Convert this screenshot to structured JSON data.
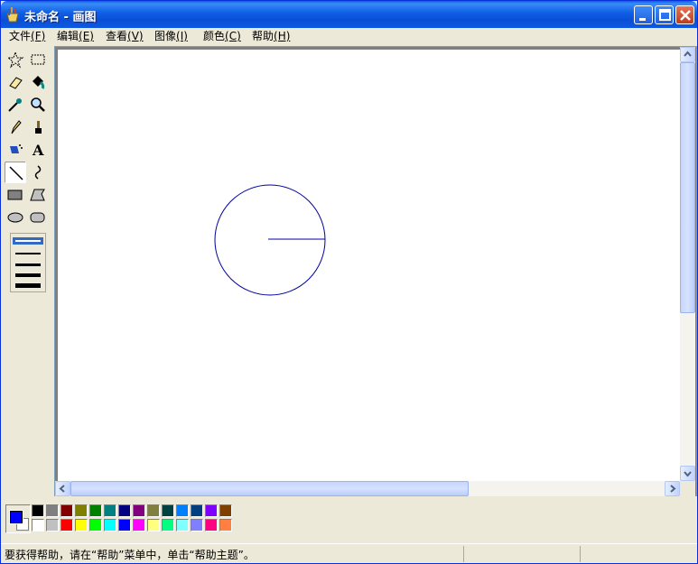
{
  "window": {
    "title": "未命名 - 画图",
    "minimize_label": "",
    "maximize_label": "",
    "close_label": ""
  },
  "menu": {
    "items": [
      {
        "label": "文件",
        "key": "(F)"
      },
      {
        "label": "编辑",
        "key": "(E)"
      },
      {
        "label": "查看",
        "key": "(V)"
      },
      {
        "label": "图像",
        "key": "(I)"
      },
      {
        "label": "颜色",
        "key": "(C)"
      },
      {
        "label": "帮助",
        "key": "(H)"
      }
    ]
  },
  "toolbox": {
    "tools": [
      {
        "name": "free-form-select",
        "icon": "star-select-icon"
      },
      {
        "name": "rect-select",
        "icon": "rect-select-icon"
      },
      {
        "name": "eraser",
        "icon": "eraser-icon"
      },
      {
        "name": "fill",
        "icon": "paint-bucket-icon"
      },
      {
        "name": "pick-color",
        "icon": "eyedropper-icon"
      },
      {
        "name": "magnifier",
        "icon": "magnifier-icon"
      },
      {
        "name": "pencil",
        "icon": "pencil-icon"
      },
      {
        "name": "brush",
        "icon": "brush-icon"
      },
      {
        "name": "airbrush",
        "icon": "airbrush-icon"
      },
      {
        "name": "text",
        "icon": "text-icon"
      },
      {
        "name": "line",
        "icon": "line-icon",
        "active": true
      },
      {
        "name": "curve",
        "icon": "curve-icon"
      },
      {
        "name": "rectangle",
        "icon": "rectangle-icon"
      },
      {
        "name": "polygon",
        "icon": "polygon-icon"
      },
      {
        "name": "ellipse",
        "icon": "ellipse-icon"
      },
      {
        "name": "rounded-rectangle",
        "icon": "rounded-rect-icon"
      }
    ],
    "line_widths_selected": 1
  },
  "canvas": {
    "shapes": [
      {
        "type": "circle",
        "color": "#0000a0"
      },
      {
        "type": "line",
        "color": "#0000a0"
      }
    ]
  },
  "colors": {
    "foreground": "#0000ff",
    "background": "#ffffff",
    "palette_top": [
      "#000000",
      "#808080",
      "#800000",
      "#808000",
      "#008000",
      "#008080",
      "#000080",
      "#800080",
      "#808040",
      "#004040",
      "#0080ff",
      "#004080",
      "#8000ff",
      "#804000"
    ],
    "palette_bottom": [
      "#ffffff",
      "#c0c0c0",
      "#ff0000",
      "#ffff00",
      "#00ff00",
      "#00ffff",
      "#0000ff",
      "#ff00ff",
      "#ffff80",
      "#00ff80",
      "#80ffff",
      "#8080ff",
      "#ff0080",
      "#ff8040"
    ]
  },
  "status": {
    "text": "要获得帮助，请在“帮助”菜单中，单击“帮助主题”。"
  }
}
